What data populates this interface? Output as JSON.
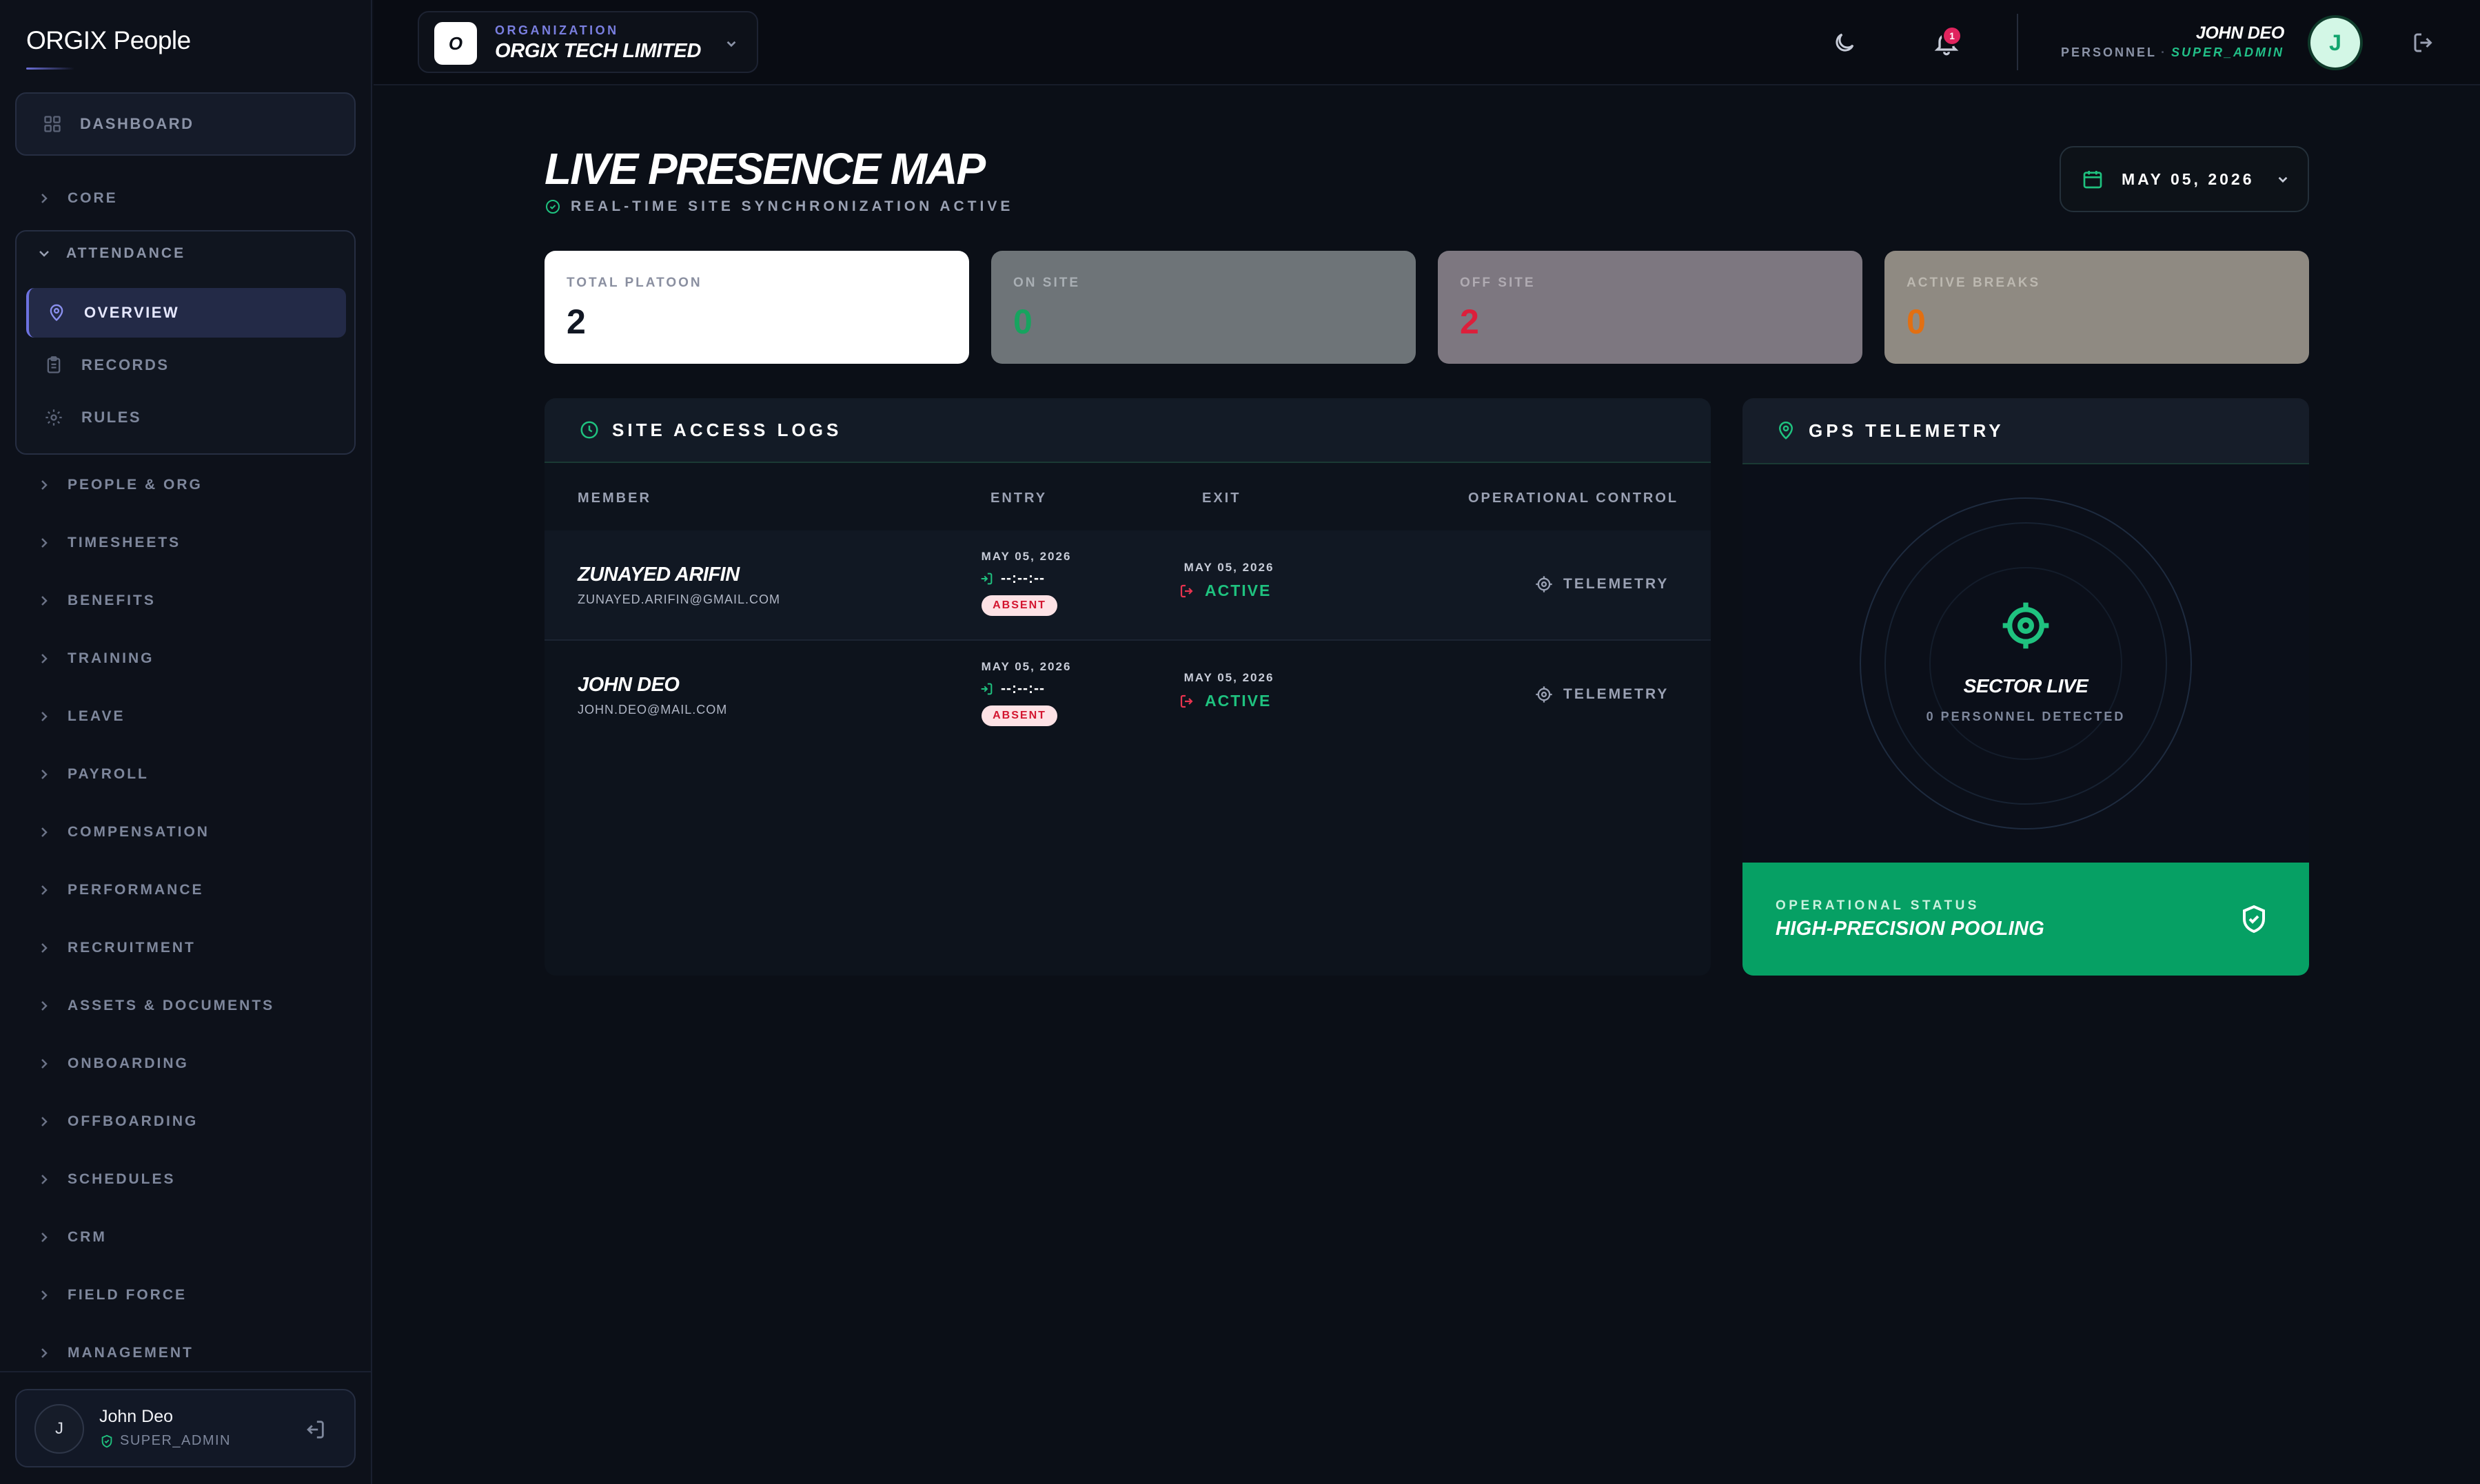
{
  "app": {
    "brand": "ORGIX People"
  },
  "sidebar": {
    "dashboard_label": "DASHBOARD",
    "core_label": "CORE",
    "attendance": {
      "label": "ATTENDANCE",
      "items": [
        {
          "label": "OVERVIEW",
          "icon": "map-pin-icon",
          "active": true
        },
        {
          "label": "RECORDS",
          "icon": "clipboard-icon"
        },
        {
          "label": "RULES",
          "icon": "gear-icon"
        }
      ]
    },
    "sections": [
      "PEOPLE & ORG",
      "TIMESHEETS",
      "BENEFITS",
      "TRAINING",
      "LEAVE",
      "PAYROLL",
      "COMPENSATION",
      "PERFORMANCE",
      "RECRUITMENT",
      "ASSETS & DOCUMENTS",
      "ONBOARDING",
      "OFFBOARDING",
      "SCHEDULES",
      "CRM",
      "FIELD FORCE",
      "MANAGEMENT"
    ],
    "user": {
      "initial": "J",
      "name": "John Deo",
      "role": "SUPER_ADMIN"
    }
  },
  "topbar": {
    "org_caption": "ORGANIZATION",
    "org_name": "ORGIX TECH LIMITED",
    "org_logo_letter": "O",
    "notification_count": "1",
    "user_name": "JOHN DEO",
    "user_title": "PERSONNEL",
    "user_role": "SUPER_ADMIN",
    "user_initial": "J"
  },
  "page": {
    "title": "LIVE PRESENCE MAP",
    "subtitle": "REAL-TIME SITE SYNCHRONIZATION ACTIVE",
    "date": "MAY 05, 2026"
  },
  "stats": [
    {
      "label": "TOTAL PLATOON",
      "value": "2"
    },
    {
      "label": "ON SITE",
      "value": "0"
    },
    {
      "label": "OFF SITE",
      "value": "2"
    },
    {
      "label": "ACTIVE BREAKS",
      "value": "0"
    }
  ],
  "logs": {
    "title": "SITE ACCESS LOGS",
    "columns": [
      "MEMBER",
      "ENTRY",
      "EXIT",
      "OPERATIONAL CONTROL"
    ],
    "rows": [
      {
        "name": "ZUNAYED ARIFIN",
        "email": "ZUNAYED.ARIFIN@GMAIL.COM",
        "entry_date": "MAY 05, 2026",
        "entry_time": "--:--:--",
        "entry_badge": "ABSENT",
        "exit_date": "MAY 05, 2026",
        "exit_status": "ACTIVE",
        "action": "TELEMETRY"
      },
      {
        "name": "JOHN DEO",
        "email": "JOHN.DEO@MAIL.COM",
        "entry_date": "MAY 05, 2026",
        "entry_time": "--:--:--",
        "entry_badge": "ABSENT",
        "exit_date": "MAY 05, 2026",
        "exit_status": "ACTIVE",
        "action": "TELEMETRY"
      }
    ]
  },
  "gps": {
    "title": "GPS TELEMETRY",
    "sector_title": "SECTOR LIVE",
    "sector_sub": "0 PERSONNEL DETECTED",
    "status_caption": "OPERATIONAL STATUS",
    "status_value": "HIGH-PRECISION POOLING"
  },
  "colors": {
    "accent": "#6d72e0",
    "success": "#06a064",
    "danger": "#dc1f3b",
    "warning": "#e26f12"
  }
}
